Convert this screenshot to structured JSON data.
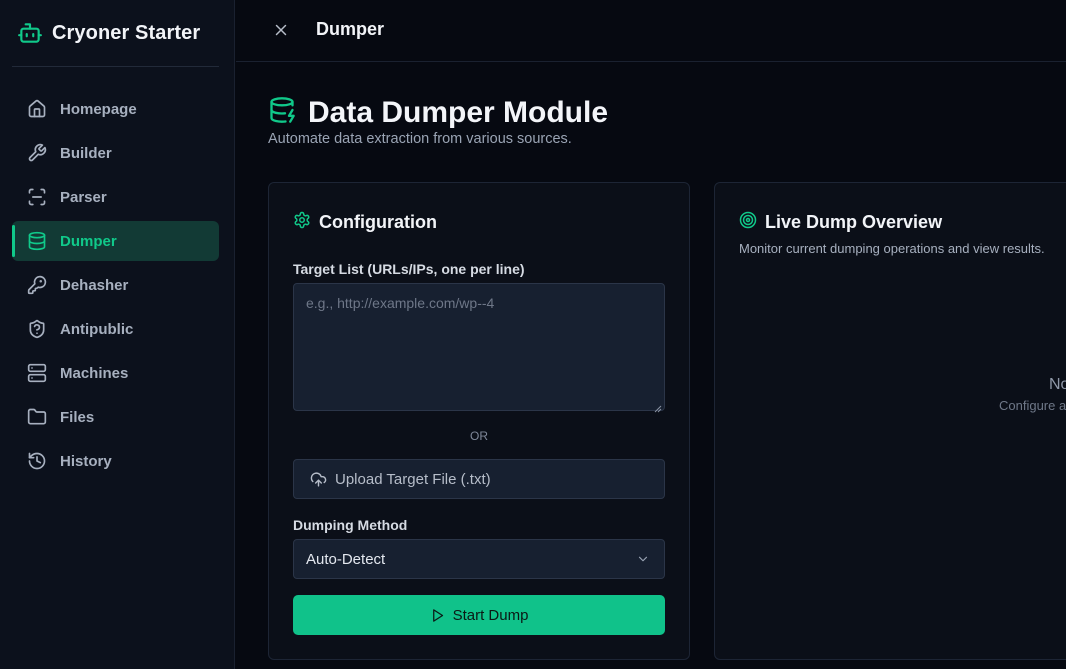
{
  "sidebar": {
    "brand": "Cryoner Starter",
    "items": [
      {
        "label": "Homepage",
        "icon": "home-icon",
        "active": false
      },
      {
        "label": "Builder",
        "icon": "wrench-icon",
        "active": false
      },
      {
        "label": "Parser",
        "icon": "scan-icon",
        "active": false
      },
      {
        "label": "Dumper",
        "icon": "database-icon",
        "active": true
      },
      {
        "label": "Dehasher",
        "icon": "key-icon",
        "active": false
      },
      {
        "label": "Antipublic",
        "icon": "shield-icon",
        "active": false
      },
      {
        "label": "Machines",
        "icon": "server-icon",
        "active": false
      },
      {
        "label": "Files",
        "icon": "folder-icon",
        "active": false
      },
      {
        "label": "History",
        "icon": "history-icon",
        "active": false
      }
    ]
  },
  "topbar": {
    "title": "Dumper"
  },
  "header": {
    "title": "Data Dumper Module",
    "subtitle": "Automate data extraction from various sources."
  },
  "config": {
    "title": "Configuration",
    "target_label": "Target List (URLs/IPs, one per line)",
    "target_placeholder": "e.g., http://example.com/wp--4",
    "or_text": "OR",
    "upload_label": "Upload Target File (.txt)",
    "method_label": "Dumping Method",
    "method_value": "Auto-Detect",
    "start_label": "Start Dump"
  },
  "live": {
    "title": "Live Dump Overview",
    "subtitle": "Monitor current dumping operations and view results.",
    "empty_title": "No",
    "empty_subtitle": "Configure a"
  },
  "colors": {
    "accent": "#10c98a",
    "background": "#060911",
    "sidebar": "#0c111c",
    "card": "#0b0f18",
    "input": "#172030"
  }
}
